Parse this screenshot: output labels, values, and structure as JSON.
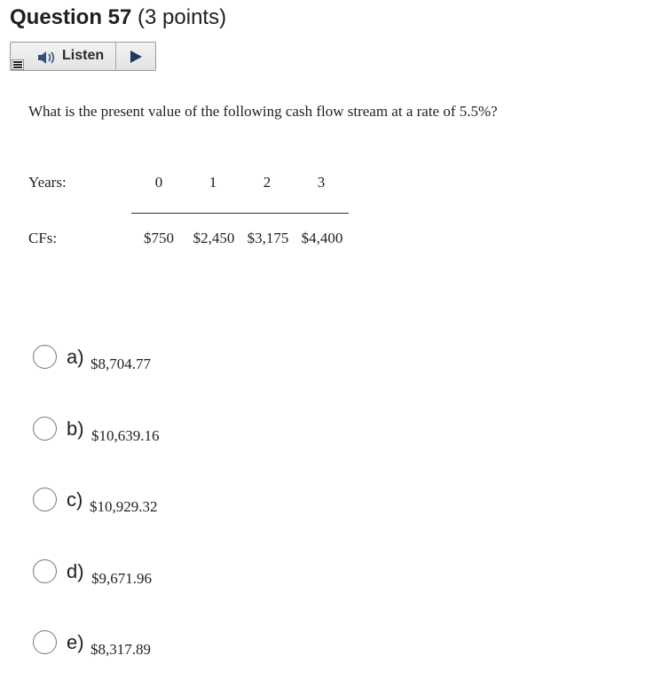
{
  "question": {
    "title": "Question 57",
    "points": "(3 points)",
    "text": "What is the present value of the following cash flow stream at a rate of 5.5%?"
  },
  "listen_bar": {
    "listen_label": "Listen",
    "icons": [
      "menu-icon",
      "speaker-icon",
      "play-icon"
    ]
  },
  "table": {
    "years_label": "Years:",
    "cfs_label": "CFs:",
    "years": [
      "0",
      "1",
      "2",
      "3"
    ],
    "cash_flows": [
      "$750",
      "$2,450",
      "$3,175",
      "$4,400"
    ]
  },
  "options": [
    {
      "letter": "a)",
      "value": "$8,704.77"
    },
    {
      "letter": "b)",
      "value": "$10,639.16"
    },
    {
      "letter": "c)",
      "value": "$10,929.32"
    },
    {
      "letter": "d)",
      "value": "$9,671.96"
    },
    {
      "letter": "e)",
      "value": "$8,317.89"
    }
  ],
  "colors": {
    "text": "#202020",
    "bar_border": "#9a9a9a",
    "radio_border": "#767676"
  }
}
